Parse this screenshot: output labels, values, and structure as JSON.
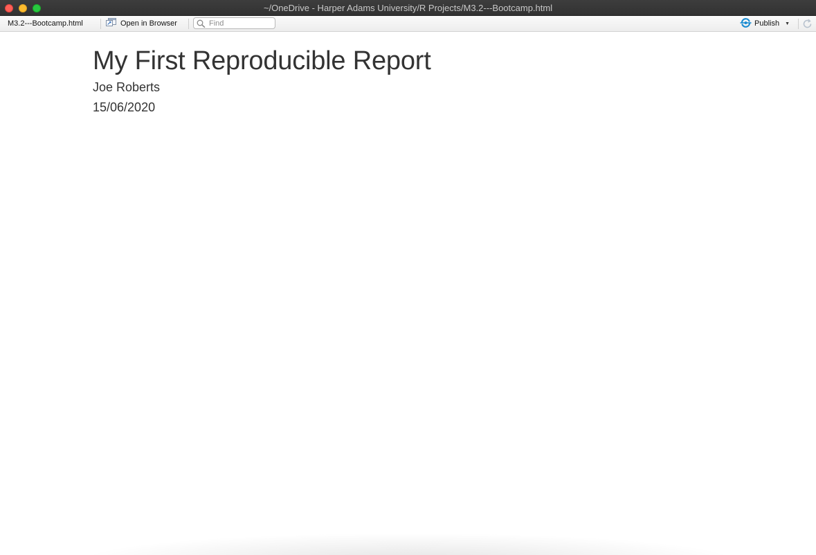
{
  "window": {
    "title": "~/OneDrive - Harper Adams University/R Projects/M3.2---Bootcamp.html",
    "controls": [
      "close",
      "minimize",
      "zoom"
    ]
  },
  "toolbar": {
    "filename": "M3.2---Bootcamp.html",
    "open_in_browser_label": "Open in Browser",
    "open_in_browser_icon": "browser-window-icon",
    "find": {
      "placeholder": "Find",
      "value": "",
      "icon": "search-icon"
    },
    "publish_label": "Publish",
    "publish_icon": "rstudio-connect-icon",
    "publish_accent": "#1a8bd1",
    "refresh_icon": "refresh-icon"
  },
  "document": {
    "title": "My First Reproducible Report",
    "author": "Joe Roberts",
    "date": "15/06/2020",
    "text_color": "#333333"
  }
}
